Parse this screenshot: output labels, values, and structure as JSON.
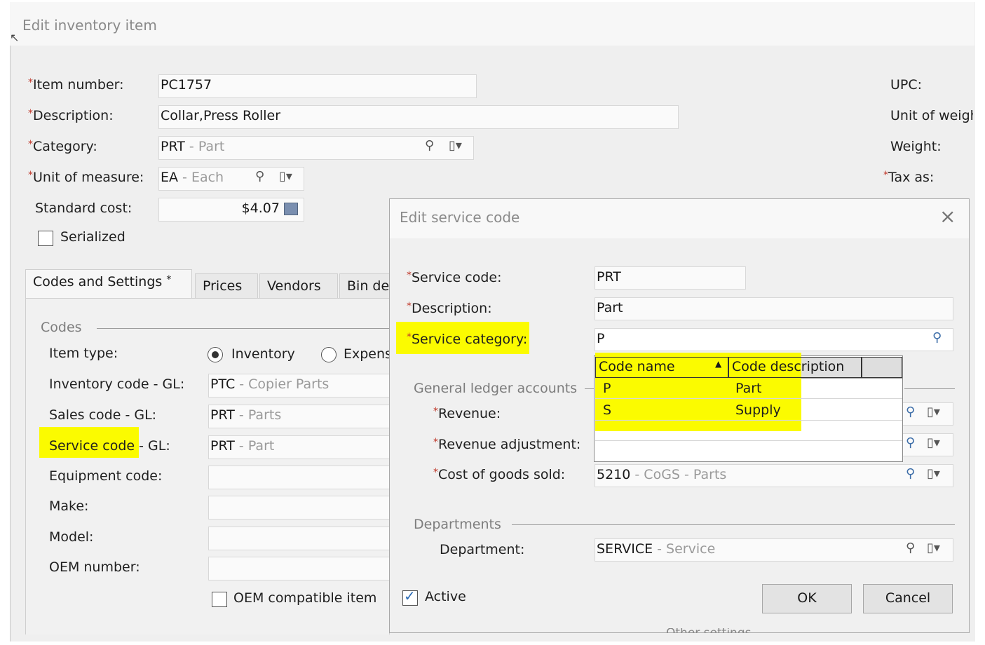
{
  "window": {
    "title": "Edit inventory item"
  },
  "form": {
    "item_number": {
      "label": "Item number:",
      "value": "PC1757"
    },
    "description": {
      "label": "Description:",
      "value": "Collar,Press Roller"
    },
    "category": {
      "label": "Category:",
      "code": "PRT",
      "sep": " - ",
      "desc": "Part"
    },
    "unit_of_measure": {
      "label": "Unit of measure:",
      "code": "EA",
      "sep": " - ",
      "desc": "Each"
    },
    "standard_cost": {
      "label": "Standard cost:",
      "value": "$4.07"
    },
    "serialized": {
      "label": "Serialized",
      "checked": false
    }
  },
  "right_labels": {
    "upc": "UPC:",
    "unit_weight": "Unit of weigh",
    "weight": "Weight:",
    "tax_as": "Tax as:"
  },
  "tabs": [
    {
      "label": "Codes and Settings",
      "marker": "*"
    },
    {
      "label": "Prices"
    },
    {
      "label": "Vendors"
    },
    {
      "label": "Bin de"
    }
  ],
  "codes": {
    "section": "Codes",
    "item_type": {
      "label": "Item type:",
      "opt1": "Inventory",
      "opt2": "Expens"
    },
    "inventory_code": {
      "label": "Inventory code - GL:",
      "code": "PTC",
      "sep": " - ",
      "desc": "Copier Parts"
    },
    "sales_code": {
      "label": "Sales code - GL:",
      "code": "PRT",
      "sep": " - ",
      "desc": "Parts"
    },
    "service_code": {
      "label_main": "Service code ",
      "label_rest": "- GL:",
      "code": "PRT",
      "sep": " - ",
      "desc": "Part"
    },
    "equipment_code": {
      "label": "Equipment code:"
    },
    "make": {
      "label": "Make:"
    },
    "model": {
      "label": "Model:"
    },
    "oem_number": {
      "label": "OEM number:"
    },
    "oem_compatible": {
      "label": "OEM compatible item",
      "checked": false
    }
  },
  "dialog": {
    "title": "Edit service code",
    "service_code": {
      "label": "Service code:",
      "value": "PRT"
    },
    "description": {
      "label": "Description:",
      "value": "Part"
    },
    "service_category": {
      "label": "Service category:",
      "value": "P"
    },
    "gl_section": "General ledger accounts",
    "revenue": {
      "label": "Revenue:"
    },
    "revenue_adjustment": {
      "label": "Revenue adjustment:"
    },
    "cogs": {
      "label": "Cost of goods sold:",
      "code": "5210",
      "sep": " - ",
      "desc": "CoGS - Parts"
    },
    "departments_section": "Departments",
    "department": {
      "label": "Department:",
      "code": "SERVICE",
      "sep": " - ",
      "desc": "Service"
    },
    "active": {
      "label": "Active",
      "checked": true
    },
    "ok_label": "OK",
    "cancel_label": "Cancel",
    "below_text": "Other settings"
  },
  "dropdown": {
    "headers": {
      "code_name": "Code name",
      "code_description": "Code description"
    },
    "rows": [
      {
        "code": "P",
        "description": "Part"
      },
      {
        "code": "S",
        "description": "Supply"
      }
    ]
  },
  "colors": {
    "highlight": "#fbfb00",
    "required": "#c0392b",
    "check": "#2a6ab5"
  }
}
